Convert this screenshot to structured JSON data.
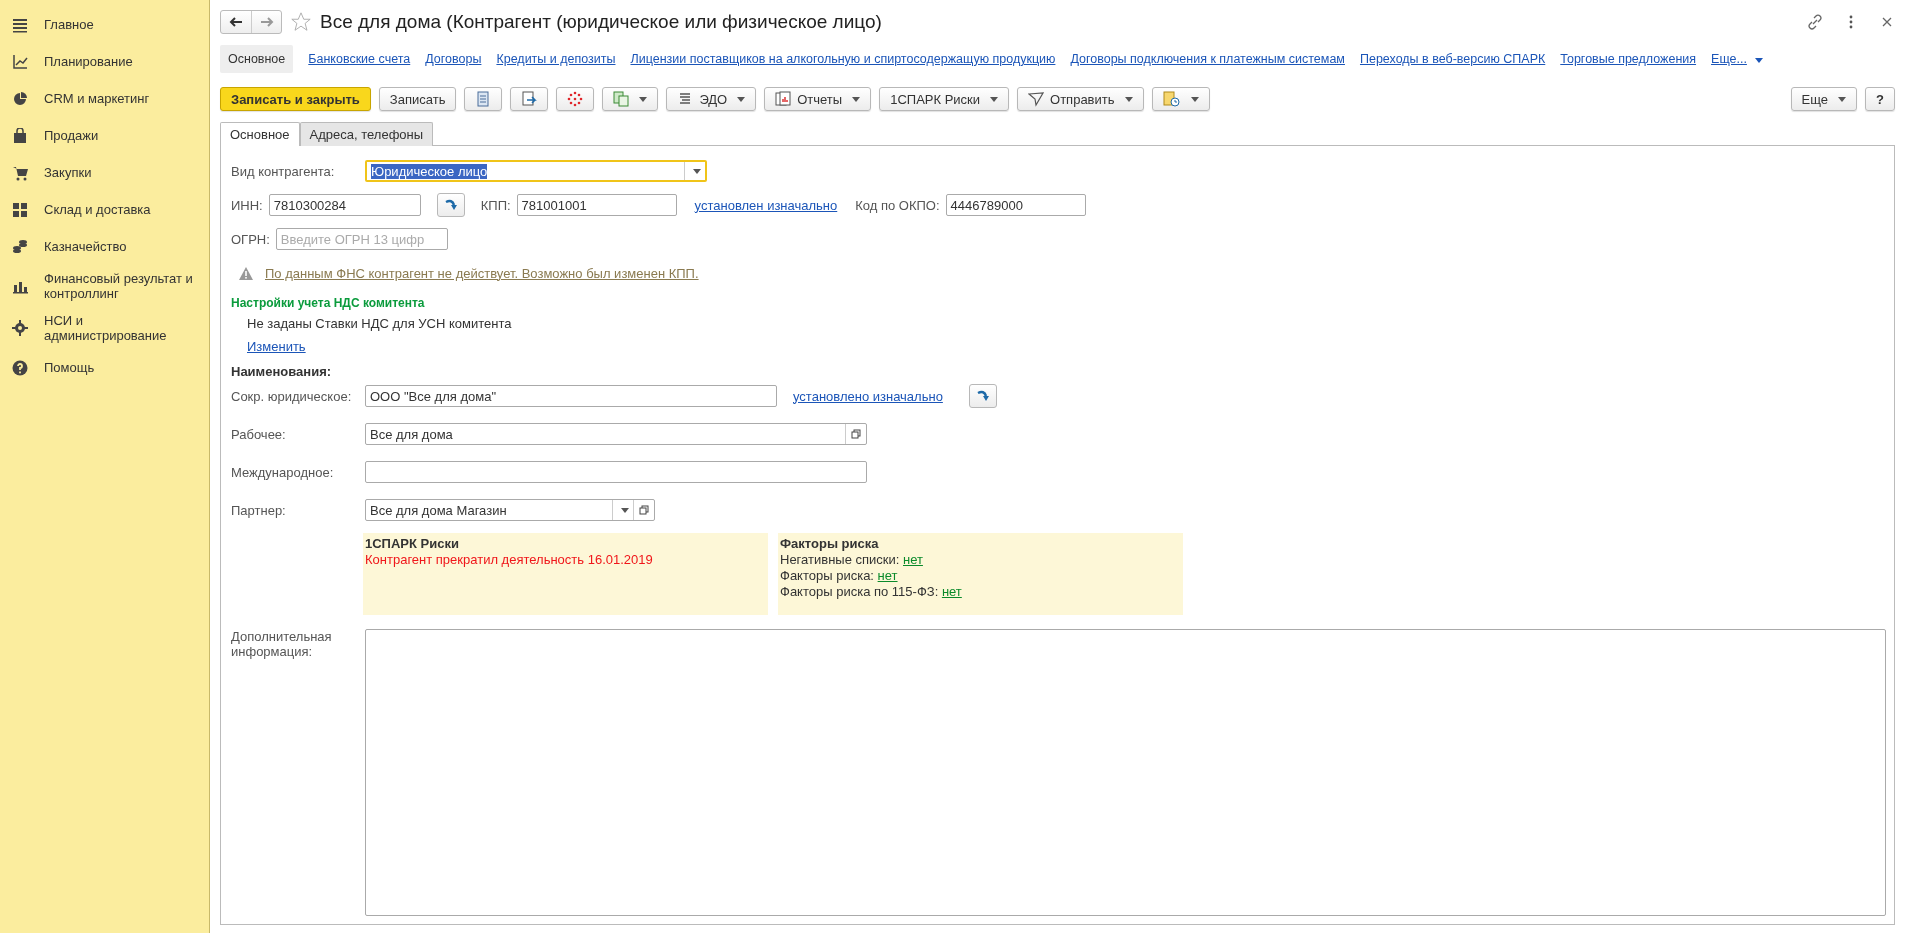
{
  "sidebar": {
    "items": [
      {
        "label": "Главное",
        "selected": false
      },
      {
        "label": "Планирование",
        "selected": false
      },
      {
        "label": "CRM и маркетинг",
        "selected": false
      },
      {
        "label": "Продажи",
        "selected": false
      },
      {
        "label": "Закупки",
        "selected": false
      },
      {
        "label": "Склад и доставка",
        "selected": false
      },
      {
        "label": "Казначейство",
        "selected": false
      },
      {
        "label": "Финансовый результат и контроллинг",
        "selected": false
      },
      {
        "label": "НСИ и администрирование",
        "selected": false
      },
      {
        "label": "Помощь",
        "selected": false
      }
    ]
  },
  "window": {
    "title": "Все для дома (Контрагент (юридическое или физическое лицо)"
  },
  "nav_links": [
    {
      "label": "Основное",
      "selected": true
    },
    {
      "label": "Банковские счета",
      "selected": false
    },
    {
      "label": "Договоры",
      "selected": false
    },
    {
      "label": "Кредиты и депозиты",
      "selected": false
    },
    {
      "label": "Лицензии поставщиков на алкогольную и спиртосодержащую продукцию",
      "selected": false
    },
    {
      "label": "Договоры подключения к платежным системам",
      "selected": false
    },
    {
      "label": "Переходы в веб-версию СПАРК",
      "selected": false
    },
    {
      "label": "Торговые предложения",
      "selected": false
    },
    {
      "label": "Еще...",
      "selected": false
    }
  ],
  "toolbar": [
    {
      "kind": "primary",
      "label": "Записать и закрыть",
      "dropdown": false
    },
    {
      "kind": "text",
      "label": "Записать",
      "dropdown": false
    },
    {
      "kind": "icon",
      "dropdown": false
    },
    {
      "kind": "icon",
      "dropdown": false
    },
    {
      "kind": "icon",
      "dropdown": false
    },
    {
      "kind": "icon",
      "dropdown": true
    },
    {
      "kind": "text",
      "label": "ЭДО",
      "dropdown": true
    },
    {
      "kind": "text",
      "label": "Отчеты",
      "dropdown": true
    },
    {
      "kind": "text",
      "label": "1СПАРК Риски",
      "dropdown": true
    },
    {
      "kind": "text",
      "label": "Отправить",
      "dropdown": true
    },
    {
      "kind": "icon",
      "dropdown": true
    }
  ],
  "toolbar_right": [
    {
      "label": "Еще",
      "dropdown": true
    },
    {
      "label": "?",
      "dropdown": false
    }
  ],
  "tabs": [
    {
      "label": "Основное",
      "selected": true
    },
    {
      "label": "Адреса, телефоны",
      "selected": false
    }
  ],
  "form": {
    "kind_field": {
      "label": "Вид контрагента:",
      "value": "Юридическое лицо"
    },
    "inn": {
      "label": "ИНН:",
      "value": "7810300284"
    },
    "kpp": {
      "label": "КПП:",
      "value": "781001001",
      "status_link": "установлен изначально"
    },
    "okpo": {
      "label": "Код по ОКПО:",
      "value": "4446789000"
    },
    "ogrn": {
      "label": "ОГРН:",
      "placeholder": "Введите ОГРН 13 цифр"
    },
    "warning": "По данным ФНС контрагент не действует. Возможно был изменен КПП.",
    "vat_section": {
      "title": "Настройки учета НДС комитента",
      "text": "Не заданы Ставки НДС для УСН комитента",
      "link": "Изменить"
    },
    "names_heading": "Наименования:",
    "short_name": {
      "label": "Сокр. юридическое:",
      "value": "ООО \"Все для дома\"",
      "status_link": "установлено изначально"
    },
    "working_name": {
      "label": "Рабочее:",
      "value": "Все для дома"
    },
    "international_name": {
      "label": "Международное:"
    },
    "partner": {
      "label": "Партнер:",
      "value": "Все для дома Магазин"
    },
    "spark_panel": {
      "title": "1СПАРК Риски",
      "alert": "Контрагент прекратил деятельность 16.01.2019"
    },
    "risk_panel": {
      "title": "Факторы риска",
      "rows": [
        {
          "label": "Негативные списки:",
          "value": "нет"
        },
        {
          "label": "Факторы риска:",
          "value": "нет"
        },
        {
          "label": "Факторы риска по 115-ФЗ:",
          "value": "нет"
        }
      ]
    },
    "notes": {
      "label": "Дополнительная информация:"
    }
  }
}
